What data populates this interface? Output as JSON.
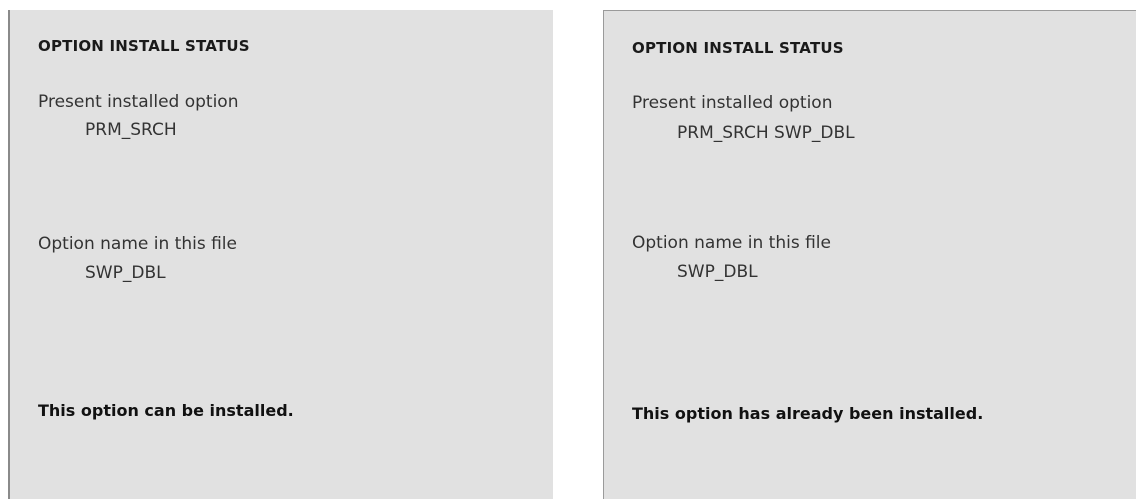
{
  "panels": [
    {
      "title": "OPTION INSTALL STATUS",
      "present_label": "Present installed option",
      "present_value": "PRM_SRCH",
      "file_label": "Option name in this file",
      "file_value": "SWP_DBL",
      "message": "This option can be installed."
    },
    {
      "title": "OPTION INSTALL STATUS",
      "present_label": "Present installed option",
      "present_value": "PRM_SRCH SWP_DBL",
      "file_label": "Option name in this file",
      "file_value": "SWP_DBL",
      "message": "This option has already been installed."
    }
  ],
  "colors": {
    "panel_background": "#e1e1e1",
    "text": "#222222"
  }
}
